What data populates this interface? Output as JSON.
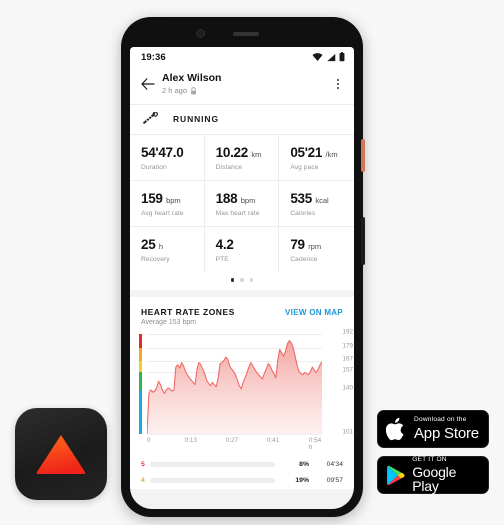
{
  "phone": {
    "statusbar": {
      "time": "19:36",
      "icons": [
        "wifi-icon",
        "signal-icon",
        "battery-icon"
      ]
    },
    "header": {
      "back_icon": "back-arrow-icon",
      "user_name": "Alex Wilson",
      "timestamp": "2 h ago",
      "lock_icon": "lock-icon",
      "menu_icon": "kebab-menu-icon"
    },
    "sport": {
      "icon": "running-shoe-icon",
      "label": "RUNNING"
    },
    "metrics": [
      {
        "value": "54'47.0",
        "unit": "",
        "label": "Duration"
      },
      {
        "value": "10.22",
        "unit": "km",
        "label": "Distance"
      },
      {
        "value": "05'21",
        "unit": "/km",
        "label": "Avg pace"
      },
      {
        "value": "159",
        "unit": "bpm",
        "label": "Avg heart rate"
      },
      {
        "value": "188",
        "unit": "bpm",
        "label": "Max heart rate"
      },
      {
        "value": "535",
        "unit": "kcal",
        "label": "Calories"
      },
      {
        "value": "25",
        "unit": "h",
        "label": "Recovery"
      },
      {
        "value": "4.2",
        "unit": "",
        "label": "PTE"
      },
      {
        "value": "79",
        "unit": "rpm",
        "label": "Cadence"
      }
    ],
    "pager": {
      "count": 3,
      "active": 0
    },
    "hr_zones": {
      "title": "HEART RATE ZONES",
      "subtitle": "Average 153 bpm",
      "link_label": "VIEW ON MAP",
      "zone_strip_colors": [
        "#e8272a",
        "#f5a623",
        "#f2d024",
        "#2eb451",
        "#1aa7dd"
      ],
      "rows": [
        {
          "zone": "5",
          "percent": "8%",
          "time": "04'34",
          "fill": 22,
          "color": "#e8312e"
        },
        {
          "zone": "4",
          "percent": "19%",
          "time": "09'57",
          "fill": 48,
          "color": "#f5a623"
        }
      ]
    },
    "colors": {
      "link": "#2196d6",
      "chart_line": "#ef6b66",
      "chart_fill": "#f7b3ae",
      "power_button": "#d0775c"
    }
  },
  "chart_data": {
    "type": "area",
    "title": "HEART RATE ZONES",
    "subtitle": "Average 153 bpm",
    "xlabel": "",
    "ylabel": "bpm",
    "ylim": [
      101,
      192
    ],
    "yticks": [
      192,
      179,
      167,
      157,
      140,
      101
    ],
    "xticks": [
      "0",
      "0:13",
      "0:27",
      "0:41",
      "0:54 h"
    ],
    "xtick_positions": [
      0,
      25,
      48.5,
      72,
      96
    ],
    "x_unit": "h",
    "grid": true,
    "legend": "none",
    "line_color": "#ef6b66",
    "fill_color": "#f7b3ae",
    "series": [
      {
        "name": "Heart rate",
        "unit": "bpm",
        "values": [
          101,
          138,
          141,
          139,
          140,
          143,
          149,
          146,
          141,
          138,
          141,
          143,
          142,
          140,
          141,
          162,
          164,
          161,
          166,
          163,
          158,
          155,
          152,
          150,
          148,
          146,
          160,
          166,
          164,
          160,
          156,
          150,
          147,
          145,
          148,
          146,
          144,
          152,
          165,
          166,
          168,
          171,
          169,
          163,
          160,
          158,
          155,
          150,
          145,
          142,
          148,
          152,
          157,
          162,
          166,
          163,
          160,
          157,
          155,
          153,
          151,
          156,
          160,
          165,
          163,
          159,
          156,
          152,
          168,
          178,
          175,
          172,
          176,
          183,
          186,
          184,
          180,
          172,
          164,
          158,
          156,
          155,
          157,
          156,
          155,
          158,
          162,
          159,
          157,
          160,
          164,
          167
        ]
      }
    ],
    "annotations": [
      {
        "text": "Average 153 bpm"
      }
    ]
  },
  "app_icon": {
    "name": "suunto-app-icon",
    "shape": "triangle",
    "colors": [
      "#ff3a1e",
      "#ff6a18"
    ]
  },
  "store_badges": [
    {
      "name": "app-store-badge",
      "small_text": "Download on the",
      "big_text": "App Store",
      "icon": "apple-logo-icon"
    },
    {
      "name": "google-play-badge",
      "small_text": "GET IT ON",
      "big_text": "Google Play",
      "icon": "google-play-icon"
    }
  ]
}
